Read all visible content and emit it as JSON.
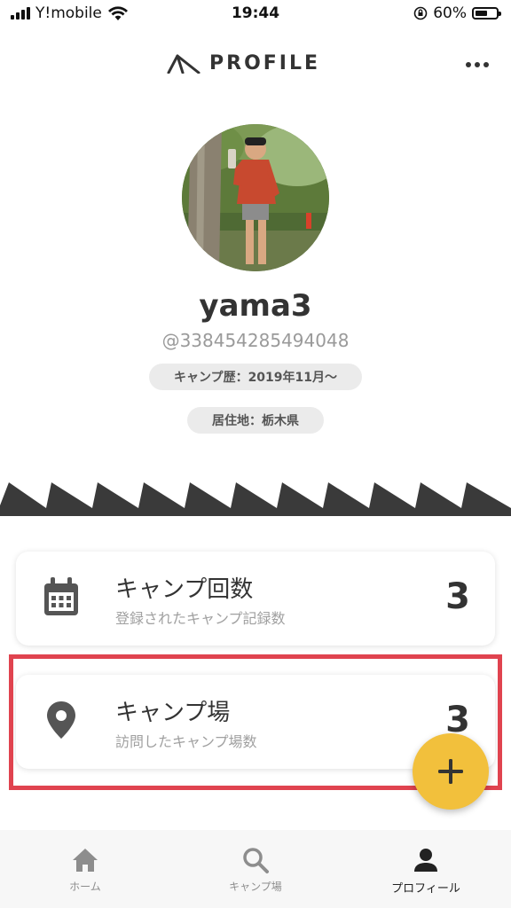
{
  "status_bar": {
    "carrier": "Y!mobile",
    "time": "19:44",
    "battery": "60%",
    "battery_level": 0.6
  },
  "header": {
    "title": "PROFILE",
    "icons": [
      "tent-logo-icon",
      "more-icon"
    ]
  },
  "profile": {
    "name": "yama3",
    "handle": "@338454285494048",
    "camp_history": "キャンプ歴：2019年11月〜",
    "residence": "居住地：栃木県"
  },
  "stats": [
    {
      "title": "キャンプ回数",
      "subtitle": "登録されたキャンプ記録数",
      "value": "3",
      "icon": "calendar-icon"
    },
    {
      "title": "キャンプ場",
      "subtitle": "訪問したキャンプ場数",
      "value": "3",
      "icon": "location-pin-icon"
    }
  ],
  "fab": {
    "icon": "plus-icon"
  },
  "nav": [
    {
      "label": "ホーム",
      "icon": "home-icon"
    },
    {
      "label": "キャンプ場",
      "icon": "search-icon"
    },
    {
      "label": "プロフィール",
      "icon": "person-icon"
    }
  ],
  "colors": {
    "accent": "#f2c03c",
    "highlight": "#e0434f",
    "dark": "#333333",
    "chip": "#ebebeb"
  }
}
